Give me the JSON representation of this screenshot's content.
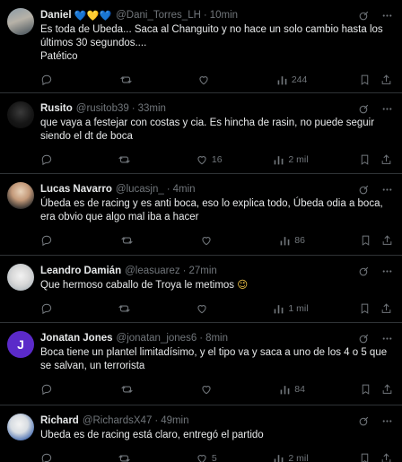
{
  "tweets": [
    {
      "name": "Daniel",
      "emojis": [
        "💙",
        "💛",
        "💙"
      ],
      "handle": "@Dani_Torres_LH",
      "time": "10min",
      "text": "Es toda de Ubeda... Saca al Changuito y no hace un solo cambio hasta los últimos 30 segundos....\nPatético",
      "replies": "",
      "retweets": "",
      "likes": "",
      "views": "244"
    },
    {
      "name": "Rusito",
      "handle": "@rusitob39",
      "time": "33min",
      "text": "que vaya a festejar con costas y cia. Es hincha de rasin, no puede seguir siendo el dt de boca",
      "replies": "",
      "retweets": "",
      "likes": "16",
      "views": "2 mil"
    },
    {
      "name": "Lucas Navarro",
      "handle": "@lucasjn_",
      "time": "4min",
      "text": "Úbeda es de racing y es anti boca, eso lo explica todo, Úbeda odia a boca, era obvio que algo mal iba a hacer",
      "replies": "",
      "retweets": "",
      "likes": "",
      "views": "86"
    },
    {
      "name": "Leandro Damián",
      "handle": "@leasuarez",
      "time": "27min",
      "text": "Que hermoso caballo de Troya le metimos",
      "text_emoji": "😉",
      "replies": "",
      "retweets": "",
      "likes": "",
      "views": "1 mil"
    },
    {
      "name": "Jonatan Jones",
      "avatar_letter": "J",
      "handle": "@jonatan_jones6",
      "time": "8min",
      "text": "Boca tiene un plantel limitadísimo, y el tipo va y saca a uno de los 4 o 5 que se salvan, un terrorista",
      "replies": "",
      "retweets": "",
      "likes": "",
      "views": "84"
    },
    {
      "name": "Richard",
      "handle": "@RichardsX47",
      "time": "49min",
      "text": "Ubeda es de racing está claro, entregó el partido",
      "replies": "",
      "retweets": "",
      "likes": "5",
      "views": "2 mil"
    }
  ],
  "ui": {
    "dot": "·"
  },
  "icons": {
    "reply": "reply-icon",
    "retweet": "retweet-icon",
    "like": "heart-icon",
    "views": "views-icon",
    "bookmark": "bookmark-icon",
    "share": "share-icon",
    "grok": "grok-icon",
    "more": "more-icon"
  },
  "colors": {
    "background": "#000000",
    "text": "#e7e9ea",
    "muted": "#71767b",
    "divider": "#2f3336",
    "avatar_j": "#5b2ac9"
  }
}
